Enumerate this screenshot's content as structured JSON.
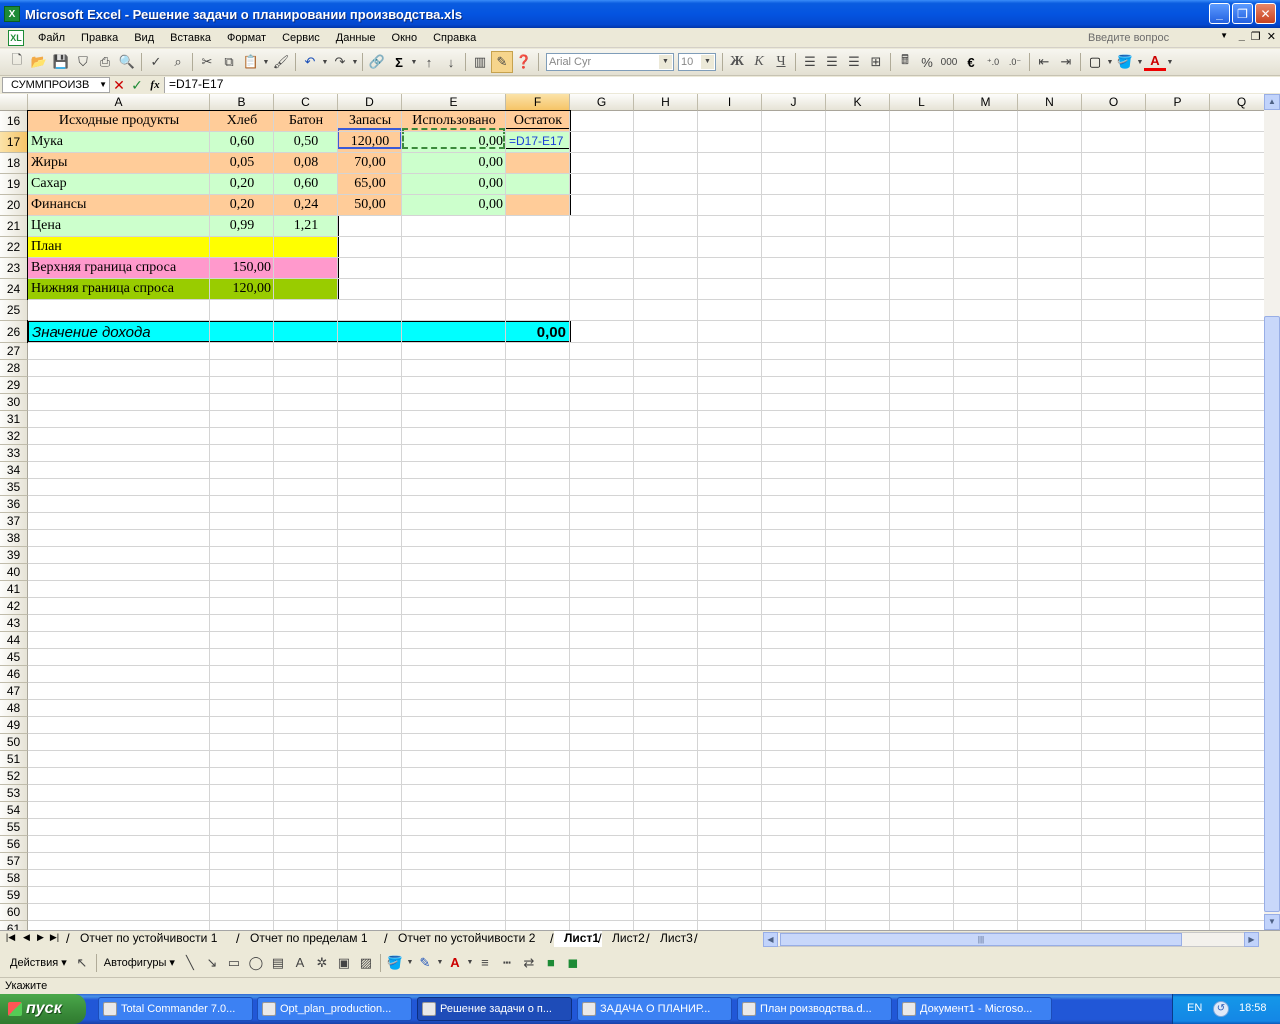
{
  "window": {
    "title": "Microsoft Excel - Решение задачи о планировании производства.xls",
    "app_icon": "X",
    "doc_icon": "XL"
  },
  "menu": [
    {
      "label": "Файл",
      "key": "F"
    },
    {
      "label": "Правка"
    },
    {
      "label": "Вид"
    },
    {
      "label": "Вставка"
    },
    {
      "label": "Формат"
    },
    {
      "label": "Сервис"
    },
    {
      "label": "Данные"
    },
    {
      "label": "Окно"
    },
    {
      "label": "Справка"
    }
  ],
  "ask_placeholder": "Введите вопрос",
  "toolbar": {
    "font_name": "Arial Cyr",
    "font_size": "10",
    "bold": "Ж",
    "italic": "К",
    "underline": "Ч",
    "sigma": "Σ",
    "percent": "%",
    "thousands": "000",
    "euro": "€"
  },
  "formula_bar": {
    "name_box": "СУММПРОИЗВ",
    "cancel": "✕",
    "enter": "✓",
    "fx": "fx",
    "formula": "=D17-E17"
  },
  "columns": [
    "A",
    "B",
    "C",
    "D",
    "E",
    "F",
    "G",
    "H",
    "I",
    "J",
    "K",
    "L",
    "M",
    "N",
    "O",
    "P",
    "Q"
  ],
  "selected_column": "F",
  "rows_first": 16,
  "rows_last": 61,
  "selected_row": 17,
  "cells": {
    "A16": "Исходные продукты",
    "B16": "Хлеб",
    "C16": "Батон",
    "D16": "Запасы",
    "E16": "Использовано",
    "F16": "Остаток",
    "A17": "Мука",
    "B17": "0,60",
    "C17": "0,50",
    "D17": "120,00",
    "E17": "0,00",
    "F17": "=D17-E17",
    "A18": "Жиры",
    "B18": "0,05",
    "C18": "0,08",
    "D18": "70,00",
    "E18": "0,00",
    "A19": "Сахар",
    "B19": "0,20",
    "C19": "0,60",
    "D19": "65,00",
    "E19": "0,00",
    "A20": "Финансы",
    "B20": "0,20",
    "C20": "0,24",
    "D20": "50,00",
    "E20": "0,00",
    "A21": "Цена",
    "B21": "0,99",
    "C21": "1,21",
    "A22": "План",
    "A23": "Верхняя граница спроса",
    "B23": "150,00",
    "A24": "Нижняя граница спроса",
    "B24": "120,00",
    "A26": "Значение дохода",
    "F26": "0,00"
  },
  "colors": {
    "peach": "#ffcc99",
    "green": "#ccffcc",
    "yellow": "#ffff00",
    "pink": "#ff99cc",
    "olive": "#99cc00",
    "cyan": "#00ffff"
  },
  "sheet_tabs": [
    {
      "label": "Отчет по устойчивости 1",
      "active": false
    },
    {
      "label": "Отчет по пределам 1",
      "active": false
    },
    {
      "label": "Отчет по устойчивости 2",
      "active": false
    },
    {
      "label": "Лист1",
      "active": true
    },
    {
      "label": "Лист2",
      "active": false
    },
    {
      "label": "Лист3",
      "active": false
    }
  ],
  "drawing_toolbar": {
    "actions": "Действия",
    "autoshapes": "Автофигуры"
  },
  "status": "Укажите",
  "taskbar": {
    "start": "пуск",
    "tasks": [
      {
        "label": "Total Commander 7.0...",
        "active": false
      },
      {
        "label": "Opt_plan_production...",
        "active": false
      },
      {
        "label": "Решение задачи о п...",
        "active": true
      },
      {
        "label": "ЗАДАЧА О ПЛАНИР...",
        "active": false
      },
      {
        "label": "План роизводства.d...",
        "active": false
      },
      {
        "label": "Документ1 - Microso...",
        "active": false
      }
    ],
    "lang": "EN",
    "clock": "18:58"
  }
}
